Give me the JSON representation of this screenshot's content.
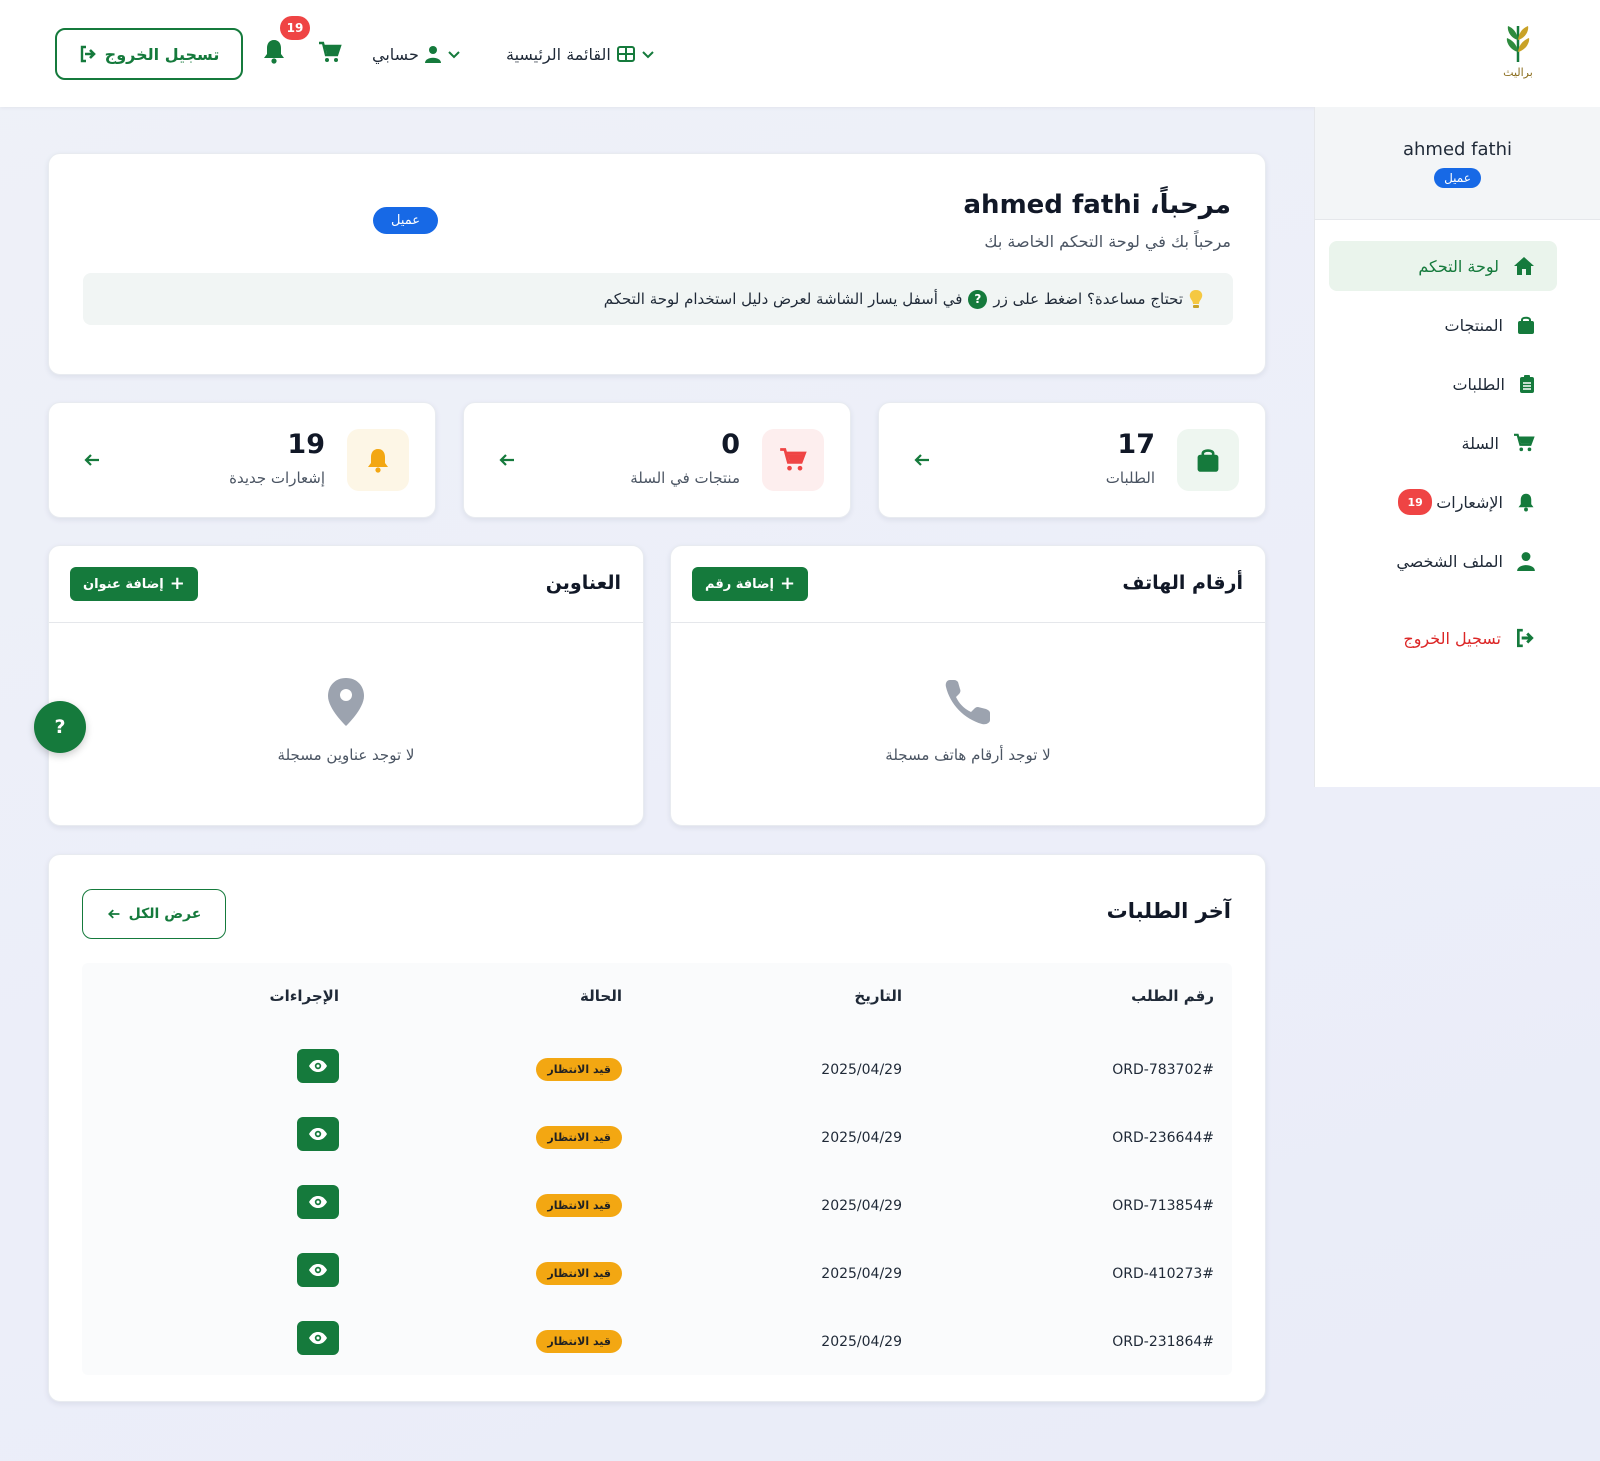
{
  "colors": {
    "primary": "#157a3c",
    "danger": "#ef4444",
    "blue": "#1769e6",
    "warning": "#f3a712"
  },
  "header": {
    "logo_text": "براليث",
    "main_menu": "القائمة الرئيسية",
    "account": "حسابي",
    "notifications_count": "19",
    "logout": "تسجيل الخروج"
  },
  "sidebar": {
    "user_name": "ahmed fathi",
    "role": "عميل",
    "items": [
      {
        "label": "لوحة التحكم",
        "icon": "home-icon"
      },
      {
        "label": "المنتجات",
        "icon": "bag-icon"
      },
      {
        "label": "الطلبات",
        "icon": "clipboard-icon"
      },
      {
        "label": "السلة",
        "icon": "cart-icon"
      },
      {
        "label": "الإشعارات",
        "icon": "bell-icon",
        "badge": "19"
      },
      {
        "label": "الملف الشخصي",
        "icon": "user-icon"
      },
      {
        "label": "تسجيل الخروج",
        "icon": "logout-icon"
      }
    ]
  },
  "welcome": {
    "title": "مرحباً، ahmed fathi",
    "subtitle": "مرحباً بك في لوحة التحكم الخاصة بك",
    "role": "عميل",
    "hint_before": "تحتاج مساعدة؟ اضغط على زر",
    "hint_after": "في أسفل يسار الشاشة لعرض دليل استخدام لوحة التحكم"
  },
  "stats": {
    "orders": {
      "value": "17",
      "label": "الطلبات"
    },
    "cart": {
      "value": "0",
      "label": "منتجات في السلة"
    },
    "notifications": {
      "value": "19",
      "label": "إشعارات جديدة"
    }
  },
  "phones": {
    "title": "أرقام الهاتف",
    "add": "إضافة رقم",
    "empty": "لا توجد أرقام هاتف مسجلة"
  },
  "addresses": {
    "title": "العناوين",
    "add": "إضافة عنوان",
    "empty": "لا توجد عناوين مسجلة"
  },
  "help_button": "?",
  "orders": {
    "title": "آخر الطلبات",
    "view_all": "عرض الكل",
    "columns": {
      "id": "رقم الطلب",
      "date": "التاريخ",
      "status": "الحالة",
      "actions": "الإجراءات"
    },
    "rows": [
      {
        "id": "ORD-783702#",
        "date": "2025/04/29",
        "status": "قيد الانتظار"
      },
      {
        "id": "ORD-236644#",
        "date": "2025/04/29",
        "status": "قيد الانتظار"
      },
      {
        "id": "ORD-713854#",
        "date": "2025/04/29",
        "status": "قيد الانتظار"
      },
      {
        "id": "ORD-410273#",
        "date": "2025/04/29",
        "status": "قيد الانتظار"
      },
      {
        "id": "ORD-231864#",
        "date": "2025/04/29",
        "status": "قيد الانتظار"
      }
    ]
  }
}
